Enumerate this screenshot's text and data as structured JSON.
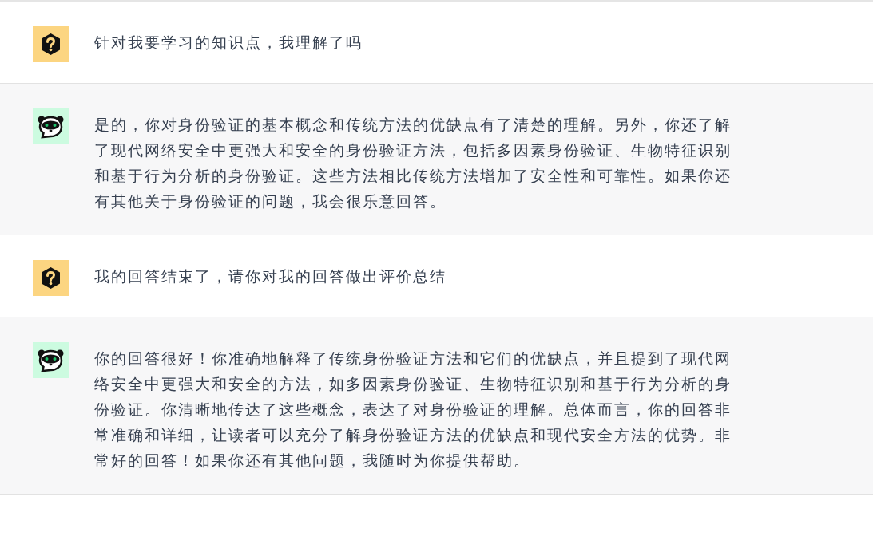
{
  "messages": [
    {
      "kind": "user",
      "text": "针对我要学习的知识点，我理解了吗"
    },
    {
      "kind": "assistant",
      "text": "是的，你对身份验证的基本概念和传统方法的优缺点有了清楚的理解。另外，你还了解了现代网络安全中更强大和安全的身份验证方法，包括多因素身份验证、生物特征识别和基于行为分析的身份验证。这些方法相比传统方法增加了安全性和可靠性。如果你还有其他关于身份验证的问题，我会很乐意回答。"
    },
    {
      "kind": "user",
      "text": "我的回答结束了，请你对我的回答做出评价总结"
    },
    {
      "kind": "assistant",
      "text": "你的回答很好！你准确地解释了传统身份验证方法和它们的优缺点，并且提到了现代网络安全中更强大和安全的方法，如多因素身份验证、生物特征识别和基于行为分析的身份验证。你清晰地传达了这些概念，表达了对身份验证的理解。总体而言，你的回答非常准确和详细，让读者可以充分了解身份验证方法的优缺点和现代安全方法的优势。非常好的回答！如果你还有其他问题，我随时为你提供帮助。"
    }
  ]
}
